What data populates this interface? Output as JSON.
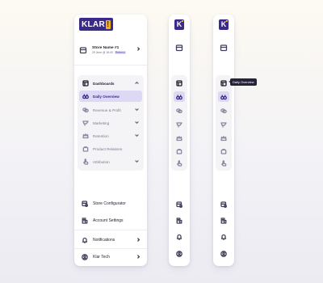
{
  "brand": {
    "logo_text": "KLAR",
    "logo_accent": "!",
    "mini_logo_text": "K",
    "color_primary": "#3b2a8a",
    "color_accent": "#f5b40c"
  },
  "store": {
    "name": "Store Name #1",
    "date": "25 June @ 16:00",
    "badge": "Refresh"
  },
  "nav": {
    "dashboards": "Dashboards",
    "items": [
      {
        "label": "Daily Overview",
        "icon": "binoculars-icon",
        "active": true
      },
      {
        "label": "Revenue & Profit",
        "icon": "coins-icon",
        "chevron": true
      },
      {
        "label": "Marketing",
        "icon": "megaphone-icon",
        "chevron": true
      },
      {
        "label": "Retention",
        "icon": "crown-icon",
        "chevron": true
      },
      {
        "label": "Product Relations",
        "icon": "shopping-bag-icon"
      },
      {
        "label": "Attribution",
        "icon": "pointer-hand-icon",
        "chevron": true
      }
    ]
  },
  "bottom": {
    "store_configurator": "Store Configurator",
    "account_settings": "Account Settings",
    "notifications": "Notifications",
    "profile": "Klar Tech"
  },
  "tooltip": "Daily Overview"
}
